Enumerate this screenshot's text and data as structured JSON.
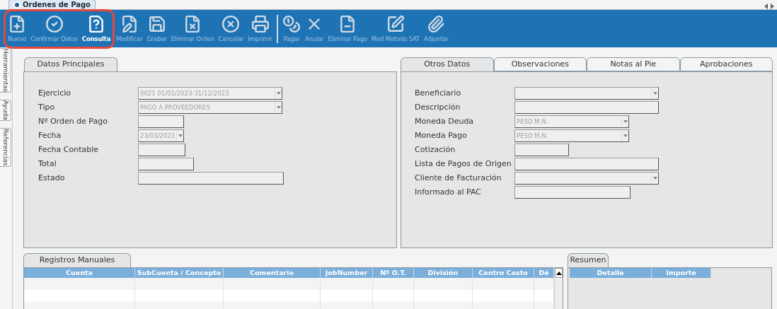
{
  "document_tab": {
    "label": "Ordenes de Pago",
    "selected": true
  },
  "toolbar": {
    "groups": [
      {
        "highlighted": true,
        "separator_before": false,
        "buttons": [
          {
            "label": "Nuevo",
            "disabled": true
          },
          {
            "label": "Confirmar Datos",
            "disabled": true
          },
          {
            "label": "Consulta",
            "disabled": false
          }
        ]
      },
      {
        "highlighted": false,
        "separator_before": false,
        "buttons": [
          {
            "label": "Modificar",
            "disabled": true
          },
          {
            "label": "Grabar",
            "disabled": true
          },
          {
            "label": "Eliminar Orden",
            "disabled": true
          },
          {
            "label": "Cancelar",
            "disabled": true
          },
          {
            "label": "Imprimir",
            "disabled": true
          }
        ]
      },
      {
        "highlighted": false,
        "separator_before": true,
        "buttons": [
          {
            "label": "Pagar",
            "disabled": true
          },
          {
            "label": "Anular",
            "disabled": true
          },
          {
            "label": "Eliminar Pago",
            "disabled": true
          },
          {
            "label": "Mod Metodo SAT",
            "disabled": true
          },
          {
            "label": "Adjuntar",
            "disabled": true
          }
        ]
      }
    ]
  },
  "side_tabs": [
    "Herramientas",
    "Ayuda",
    "Referencias"
  ],
  "main_panel": {
    "tabs": [
      {
        "label": "Datos Principales",
        "selected": true
      }
    ],
    "fields": [
      {
        "label": "Ejercicio",
        "kind": "select",
        "value": "0021 01/01/2023-31/12/2023"
      },
      {
        "label": "Tipo",
        "kind": "select",
        "value": "PAGO A PROVEEDORES"
      },
      {
        "label": "Nº Orden de Pago",
        "kind": "text"
      },
      {
        "label": "Fecha",
        "kind": "select",
        "value": "23/03/2023"
      },
      {
        "label": "Fecha Contable",
        "kind": "text"
      },
      {
        "label": "Total",
        "kind": "text"
      },
      {
        "label": "Estado",
        "kind": "text"
      }
    ]
  },
  "other_panel": {
    "tabs": [
      {
        "label": "Otros Datos",
        "selected": true
      },
      {
        "label": "Observaciones",
        "selected": false
      },
      {
        "label": "Notas al Pie",
        "selected": false
      },
      {
        "label": "Aprobaciones",
        "selected": false
      }
    ],
    "fields": [
      {
        "label": "Beneficiario",
        "kind": "select"
      },
      {
        "label": "Descripción",
        "kind": "text"
      },
      {
        "label": "Moneda Deuda",
        "kind": "select",
        "value": "PESO M.N."
      },
      {
        "label": "Moneda Pago",
        "kind": "select",
        "value": "PESO M.N."
      },
      {
        "label": "Cotización",
        "kind": "text"
      },
      {
        "label": "Lista de Pagos de Origen",
        "kind": "text"
      },
      {
        "label": "Cliente de Facturación",
        "kind": "select"
      },
      {
        "label": "Informado al PAC",
        "kind": "text"
      }
    ]
  },
  "manual_records": {
    "tab": {
      "label": "Registros Manuales",
      "selected": true
    },
    "columns": [
      "Cuenta",
      "SubCuenta / Concepto",
      "Comentario",
      "JobNumber",
      "Nº O.T.",
      "División",
      "Centro Costo",
      "Dé"
    ]
  },
  "summary": {
    "tab": {
      "label": "Resumen",
      "selected": true
    },
    "columns": [
      "Detalle",
      "Importe"
    ]
  }
}
